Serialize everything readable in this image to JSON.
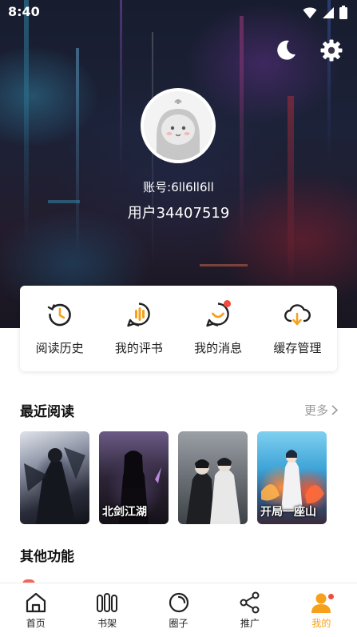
{
  "status_bar": {
    "time": "8:40"
  },
  "profile": {
    "account_label": "账号:6ll6ll6ll",
    "username": "用户34407519"
  },
  "quick_actions": [
    {
      "label": "阅读历史",
      "icon": "history-icon",
      "badge": false
    },
    {
      "label": "我的评书",
      "icon": "review-icon",
      "badge": false
    },
    {
      "label": "我的消息",
      "icon": "message-icon",
      "badge": true
    },
    {
      "label": "缓存管理",
      "icon": "cloud-download-icon",
      "badge": false
    }
  ],
  "recent": {
    "title": "最近阅读",
    "more_label": "更多",
    "books": [
      {
        "cover_text": ""
      },
      {
        "cover_text": "北剑江湖"
      },
      {
        "cover_text": ""
      },
      {
        "cover_text": "开局一座山"
      }
    ]
  },
  "other": {
    "title": "其他功能"
  },
  "tabs": [
    {
      "label": "首页",
      "icon": "home-icon",
      "active": false
    },
    {
      "label": "书架",
      "icon": "bookshelf-icon",
      "active": false
    },
    {
      "label": "圈子",
      "icon": "circle-icon",
      "active": false
    },
    {
      "label": "推广",
      "icon": "share-icon",
      "active": false
    },
    {
      "label": "我的",
      "icon": "profile-icon",
      "active": true
    }
  ],
  "colors": {
    "accent": "#f7a11a",
    "badge": "#f04b3c",
    "text": "#222222"
  }
}
